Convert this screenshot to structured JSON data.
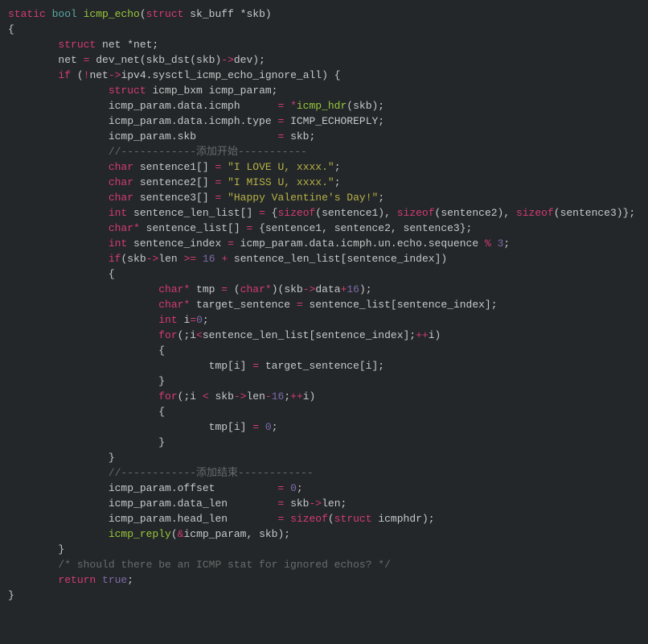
{
  "code": {
    "l1_static": "static",
    "l1_bool": " bool",
    "l1_fn": " icmp_echo",
    "l1_p1": "(",
    "l1_struct": "struct",
    "l1_rest": " sk_buff *skb)",
    "l2": "{",
    "l3_struct": "        struct",
    "l3_rest": " net *net;",
    "l4": "",
    "l5_a": "        net ",
    "l5_op": "=",
    "l5_b": " dev_net(skb_dst(skb)",
    "l5_arrow": "->",
    "l5_c": "dev);",
    "l6_if": "        if",
    "l6_a": " (",
    "l6_not": "!",
    "l6_b": "net",
    "l6_arrow": "->",
    "l6_c": "ipv4.sysctl_icmp_echo_ignore_all) {",
    "l7_struct": "                struct",
    "l7_rest": " icmp_bxm icmp_param;",
    "l8": "",
    "l9_a": "                icmp_param.data.icmph      ",
    "l9_eq": "= *",
    "l9_fn": "icmp_hdr",
    "l9_b": "(skb);",
    "l10_a": "                icmp_param.data.icmph.type ",
    "l10_eq": "=",
    "l10_b": " ICMP_ECHOREPLY;",
    "l11_a": "                icmp_param.skb             ",
    "l11_eq": "=",
    "l11_b": " skb;",
    "l12": "                //------------添加开始-----------",
    "l13_char": "                char",
    "l13_a": " sentence1[] ",
    "l13_eq": "=",
    "l13_sp": " ",
    "l13_str": "\"I LOVE U, xxxx.\"",
    "l13_b": ";",
    "l14_char": "                char",
    "l14_a": " sentence2[] ",
    "l14_eq": "=",
    "l14_sp": " ",
    "l14_str": "\"I MISS U, xxxx.\"",
    "l14_b": ";",
    "l15_char": "                char",
    "l15_a": " sentence3[] ",
    "l15_eq": "=",
    "l15_sp": " ",
    "l15_str": "\"Happy Valentine's Day!\"",
    "l15_b": ";",
    "l16_int": "                int",
    "l16_a": " sentence_len_list[] ",
    "l16_eq": "=",
    "l16_b": " {",
    "l16_s1": "sizeof",
    "l16_c": "(sentence1), ",
    "l16_s2": "sizeof",
    "l16_d": "(sentence2), ",
    "l16_s3": "sizeof",
    "l16_e": "(sentence3)};",
    "l17_char": "                char",
    "l17_op": "*",
    "l17_a": " sentence_list[] ",
    "l17_eq": "=",
    "l17_b": " {sentence1, sentence2, sentence3};",
    "l18_int": "                int",
    "l18_a": " sentence_index ",
    "l18_eq": "=",
    "l18_b": " icmp_param.data.icmph.un.echo.sequence ",
    "l18_mod": "%",
    "l18_sp": " ",
    "l18_num": "3",
    "l18_c": ";",
    "l19_if": "                if",
    "l19_a": "(skb",
    "l19_arrow": "->",
    "l19_b": "len ",
    "l19_ge": ">=",
    "l19_sp": " ",
    "l19_num": "16",
    "l19_plus": " +",
    "l19_c": " sentence_len_list[sentence_index])",
    "l20": "                {",
    "l21_char": "                        char",
    "l21_op": "*",
    "l21_a": " tmp ",
    "l21_eq": "=",
    "l21_b": " (",
    "l21_char2": "char",
    "l21_op2": "*",
    "l21_c": ")(skb",
    "l21_arrow": "->",
    "l21_d": "data",
    "l21_plus": "+",
    "l21_num": "16",
    "l21_e": ");",
    "l22_char": "                        char",
    "l22_op": "*",
    "l22_a": " target_sentence ",
    "l22_eq": "=",
    "l22_b": " sentence_list[sentence_index];",
    "l23_int": "                        int",
    "l23_a": " i",
    "l23_eq": "=",
    "l23_num": "0",
    "l23_b": ";",
    "l24_for": "                        for",
    "l24_a": "(;i",
    "l24_lt": "<",
    "l24_b": "sentence_len_list[sentence_index];",
    "l24_inc": "++",
    "l24_c": "i)",
    "l25": "                        {",
    "l26_a": "                                tmp[i] ",
    "l26_eq": "=",
    "l26_b": " target_sentence[i];",
    "l27": "                        }",
    "l28_for": "                        for",
    "l28_a": "(;i ",
    "l28_lt": "<",
    "l28_b": " skb",
    "l28_arrow": "->",
    "l28_c": "len",
    "l28_minus": "-",
    "l28_num": "16",
    "l28_d": ";",
    "l28_inc": "++",
    "l28_e": "i)",
    "l29": "                        {",
    "l30_a": "                                tmp[i] ",
    "l30_eq": "=",
    "l30_sp": " ",
    "l30_num": "0",
    "l30_b": ";",
    "l31": "                        }",
    "l32": "                }",
    "l33": "                //------------添加结束------------",
    "l34_a": "                icmp_param.offset          ",
    "l34_eq": "=",
    "l34_sp": " ",
    "l34_num": "0",
    "l34_b": ";",
    "l35_a": "                icmp_param.data_len        ",
    "l35_eq": "=",
    "l35_b": " skb",
    "l35_arrow": "->",
    "l35_c": "len;",
    "l36_a": "                icmp_param.head_len        ",
    "l36_eq": "=",
    "l36_sp": " ",
    "l36_sizeof": "sizeof",
    "l36_b": "(",
    "l36_struct": "struct",
    "l36_c": " icmphdr);",
    "l37_fn": "                icmp_reply",
    "l37_a": "(",
    "l37_amp": "&",
    "l37_b": "icmp_param, skb);",
    "l38": "        }",
    "l39": "        /* should there be an ICMP stat for ignored echos? */",
    "l40_ret": "        return",
    "l40_sp": " ",
    "l40_true": "true",
    "l40_b": ";",
    "l41": "}"
  }
}
